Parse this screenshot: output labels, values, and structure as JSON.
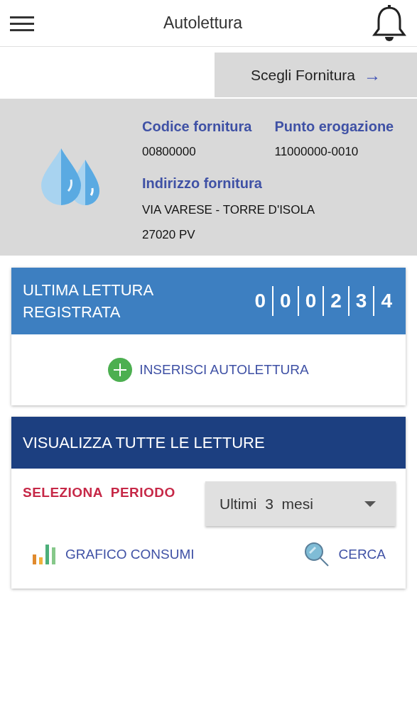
{
  "header": {
    "title": "Autolettura"
  },
  "supply_button": {
    "label": "Scegli Fornitura",
    "arrow": "→"
  },
  "supply": {
    "fields": [
      {
        "label": "Codice fornitura",
        "value": "00800000"
      },
      {
        "label": "Punto erogazione",
        "value": "11000000-0010"
      }
    ],
    "address": {
      "label": "Indirizzo fornitura",
      "lines": [
        "VIA VARESE - TORRE D'ISOLA",
        "27020 PV"
      ]
    }
  },
  "last_reading": {
    "title": "ULTIMA LETTURA REGISTRATA",
    "digits": [
      "0",
      "0",
      "0",
      "2",
      "3",
      "4"
    ],
    "action": "INSERISCI AUTOLETTURA"
  },
  "all_readings": {
    "title": "VISUALIZZA TUTTE LE LETTURE",
    "period_label": "SELEZIONA  PERIODO",
    "period_value": "Ultimi  3  mesi",
    "chart_link": "GRAFICO CONSUMI",
    "search_link": "CERCA"
  }
}
